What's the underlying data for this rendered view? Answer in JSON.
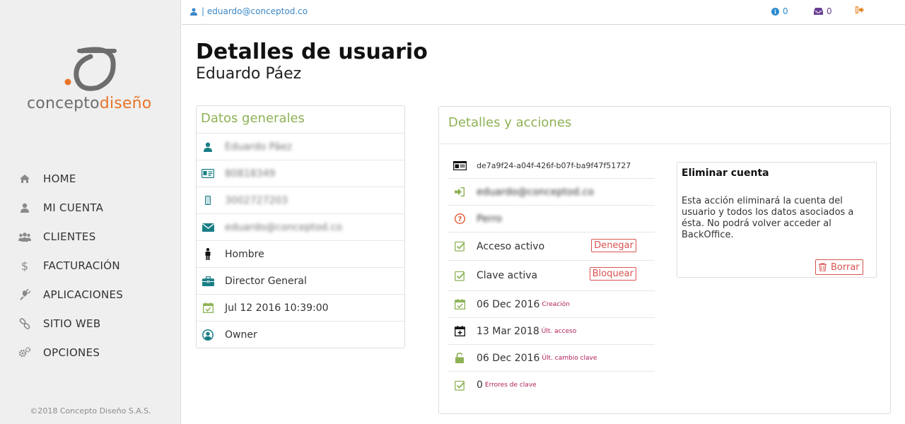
{
  "brand": {
    "name_part1": "concepto",
    "name_part2": "diseño",
    "colors": {
      "orange": "#e8742a",
      "gray": "#6d6d6d"
    }
  },
  "nav": {
    "items": [
      {
        "label": "HOME",
        "icon": "home-icon"
      },
      {
        "label": "MI CUENTA",
        "icon": "user-icon"
      },
      {
        "label": "CLIENTES",
        "icon": "users-icon"
      },
      {
        "label": "FACTURACIÓN",
        "icon": "dollar-icon"
      },
      {
        "label": "APLICACIONES",
        "icon": "plug-icon"
      },
      {
        "label": "SITIO WEB",
        "icon": "link-icon"
      },
      {
        "label": "OPCIONES",
        "icon": "cogs-icon"
      }
    ]
  },
  "copyright": "©2018 Concepto Diseño S.A.S.",
  "topbar": {
    "user": "| eduardo@conceptod.co",
    "info_count": "0",
    "inbox_count": "0"
  },
  "page": {
    "title": "Detalles de usuario",
    "subtitle": "Eduardo Páez"
  },
  "general": {
    "heading": "Datos generales",
    "name": "Eduardo Páez",
    "id_number": "80818349",
    "phone": "3002727203",
    "email": "eduardo@conceptod.co",
    "gender": "Hombre",
    "position": "Director General",
    "created": "Jul 12 2016 10:39:00",
    "role": "Owner"
  },
  "details": {
    "heading": "Detalles y acciones",
    "uuid": "de7a9f24-a04f-426f-b07f-ba9f47f51727",
    "login": "eduardo@conceptod.co",
    "question": "Perro",
    "access_label": "Acceso activo",
    "deny_button": "Denegar",
    "password_label": "Clave activa",
    "block_button": "Bloquear",
    "created_date": "06 Dec 2016",
    "created_note": "Creación",
    "last_access_date": "13 Mar 2018",
    "last_access_note": "Últ. acceso",
    "pw_change_date": "06 Dec 2016",
    "pw_change_note": "Últ. cambio clave",
    "pw_errors": "0",
    "pw_errors_note": "Errores de clave"
  },
  "delete_account": {
    "title": "Eliminar cuenta",
    "description": "Esta acción eliminará la cuenta del usuario y todos los datos asociados a ésta. No podrá volver acceder al BackOffice.",
    "button": "Borrar"
  },
  "colors": {
    "accent_green": "#8db255",
    "teal": "#1a7e86",
    "danger": "#d9534f",
    "link_blue": "#3a87c7"
  }
}
